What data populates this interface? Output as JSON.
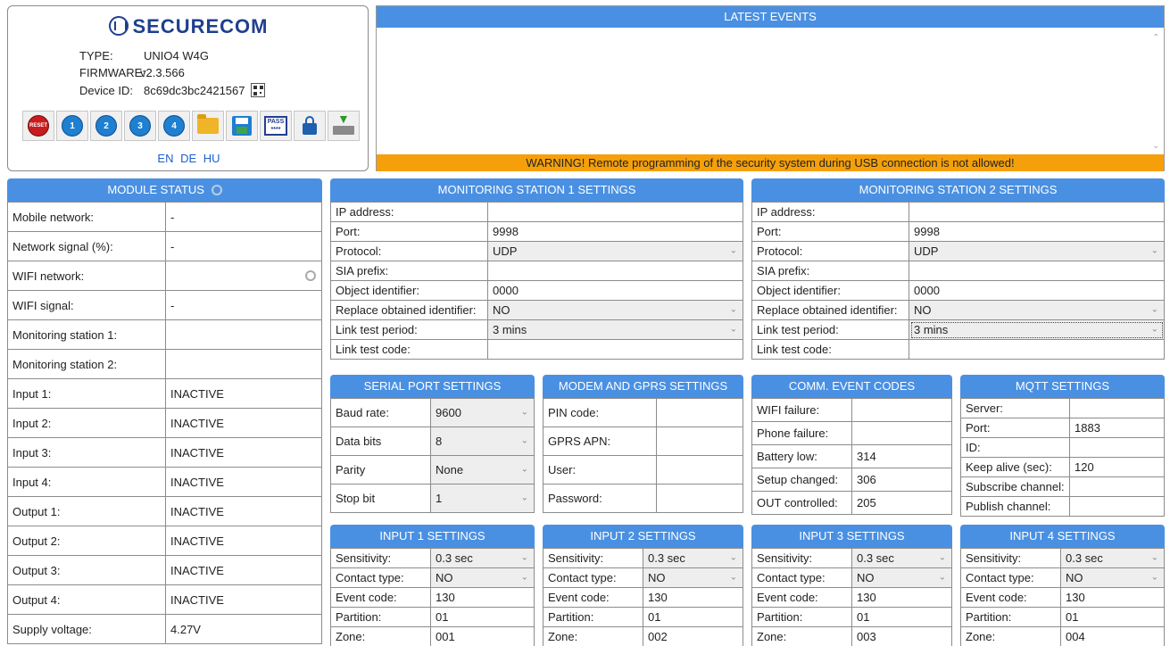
{
  "device": {
    "brand": "SECURECOM",
    "type_label": "TYPE:",
    "type_value": "UNIO4 W4G",
    "firmware_label": "FIRMWARE:",
    "firmware_value": "v2.3.566",
    "device_id_label": "Device ID:",
    "device_id_value": "8c69dc3bc2421567",
    "toolbar_labels": {
      "reset": "RESET",
      "out1": "1",
      "out2": "2",
      "out3": "3",
      "out4": "4",
      "pass": "PASS ****"
    },
    "languages": [
      "EN",
      "DE",
      "HU"
    ]
  },
  "events": {
    "title": "LATEST EVENTS",
    "warning": "WARNING! Remote programming of the security system during USB connection is not allowed!"
  },
  "module_status": {
    "title": "MODULE STATUS",
    "rows": [
      {
        "label": "Mobile network:",
        "value": "-"
      },
      {
        "label": "Network signal (%):",
        "value": "-"
      },
      {
        "label": "WIFI network:",
        "value": ""
      },
      {
        "label": "WIFI signal:",
        "value": "-"
      },
      {
        "label": "Monitoring station 1:",
        "value": ""
      },
      {
        "label": "Monitoring station 2:",
        "value": ""
      },
      {
        "label": "Input 1:",
        "value": "INACTIVE"
      },
      {
        "label": "Input 2:",
        "value": "INACTIVE"
      },
      {
        "label": "Input 3:",
        "value": "INACTIVE"
      },
      {
        "label": "Input 4:",
        "value": "INACTIVE"
      },
      {
        "label": "Output 1:",
        "value": "INACTIVE"
      },
      {
        "label": "Output 2:",
        "value": "INACTIVE"
      },
      {
        "label": "Output 3:",
        "value": "INACTIVE"
      },
      {
        "label": "Output 4:",
        "value": "INACTIVE"
      },
      {
        "label": "Supply voltage:",
        "value": "4.27V"
      }
    ]
  },
  "ms1": {
    "title": "MONITORING STATION 1 SETTINGS",
    "rows": [
      {
        "label": "IP address:",
        "value": ""
      },
      {
        "label": "Port:",
        "value": "9998"
      },
      {
        "label": "Protocol:",
        "value": "UDP"
      },
      {
        "label": "SIA prefix:",
        "value": ""
      },
      {
        "label": "Object identifier:",
        "value": "0000"
      },
      {
        "label": "Replace obtained identifier:",
        "value": "NO"
      },
      {
        "label": "Link test period:",
        "value": "3 mins"
      },
      {
        "label": "Link test code:",
        "value": ""
      }
    ]
  },
  "ms2": {
    "title": "MONITORING STATION 2 SETTINGS",
    "rows": [
      {
        "label": "IP address:",
        "value": ""
      },
      {
        "label": "Port:",
        "value": "9998"
      },
      {
        "label": "Protocol:",
        "value": "UDP"
      },
      {
        "label": "SIA prefix:",
        "value": ""
      },
      {
        "label": "Object identifier:",
        "value": "0000"
      },
      {
        "label": "Replace obtained identifier:",
        "value": "NO"
      },
      {
        "label": "Link test period:",
        "value": "3 mins"
      },
      {
        "label": "Link test code:",
        "value": ""
      }
    ]
  },
  "serial": {
    "title": "SERIAL PORT SETTINGS",
    "rows": [
      {
        "label": "Baud rate:",
        "value": "9600"
      },
      {
        "label": "Data bits",
        "value": "8"
      },
      {
        "label": "Parity",
        "value": "None"
      },
      {
        "label": "Stop bit",
        "value": "1"
      }
    ]
  },
  "modem": {
    "title": "MODEM AND GPRS SETTINGS",
    "rows": [
      {
        "label": "PIN code:",
        "value": ""
      },
      {
        "label": "GPRS APN:",
        "value": ""
      },
      {
        "label": "User:",
        "value": ""
      },
      {
        "label": "Password:",
        "value": ""
      }
    ]
  },
  "comm": {
    "title": "COMM. EVENT CODES",
    "rows": [
      {
        "label": "WIFI failure:",
        "value": ""
      },
      {
        "label": "Phone failure:",
        "value": ""
      },
      {
        "label": "Battery low:",
        "value": "314"
      },
      {
        "label": "Setup changed:",
        "value": "306"
      },
      {
        "label": "OUT controlled:",
        "value": "205"
      }
    ]
  },
  "mqtt": {
    "title": "MQTT SETTINGS",
    "rows": [
      {
        "label": "Server:",
        "value": ""
      },
      {
        "label": "Port:",
        "value": "1883"
      },
      {
        "label": "ID:",
        "value": ""
      },
      {
        "label": "Keep alive (sec):",
        "value": "120"
      },
      {
        "label": "Subscribe channel:",
        "value": ""
      },
      {
        "label": "Publish channel:",
        "value": ""
      }
    ]
  },
  "inputs": [
    {
      "title": "INPUT 1 SETTINGS",
      "sensitivity": "0.3 sec",
      "contact": "NO",
      "event_code": "130",
      "partition": "01",
      "zone": "001"
    },
    {
      "title": "INPUT 2 SETTINGS",
      "sensitivity": "0.3 sec",
      "contact": "NO",
      "event_code": "130",
      "partition": "01",
      "zone": "002"
    },
    {
      "title": "INPUT 3 SETTINGS",
      "sensitivity": "0.3 sec",
      "contact": "NO",
      "event_code": "130",
      "partition": "01",
      "zone": "003"
    },
    {
      "title": "INPUT 4 SETTINGS",
      "sensitivity": "0.3 sec",
      "contact": "NO",
      "event_code": "130",
      "partition": "01",
      "zone": "004"
    }
  ],
  "input_labels": {
    "sensitivity": "Sensitivity:",
    "contact": "Contact type:",
    "event_code": "Event code:",
    "partition": "Partition:",
    "zone": "Zone:"
  },
  "colors": {
    "header_blue": "#4a90e2",
    "warning_orange": "#f5a00a",
    "brand_blue": "#1f3f8f"
  }
}
